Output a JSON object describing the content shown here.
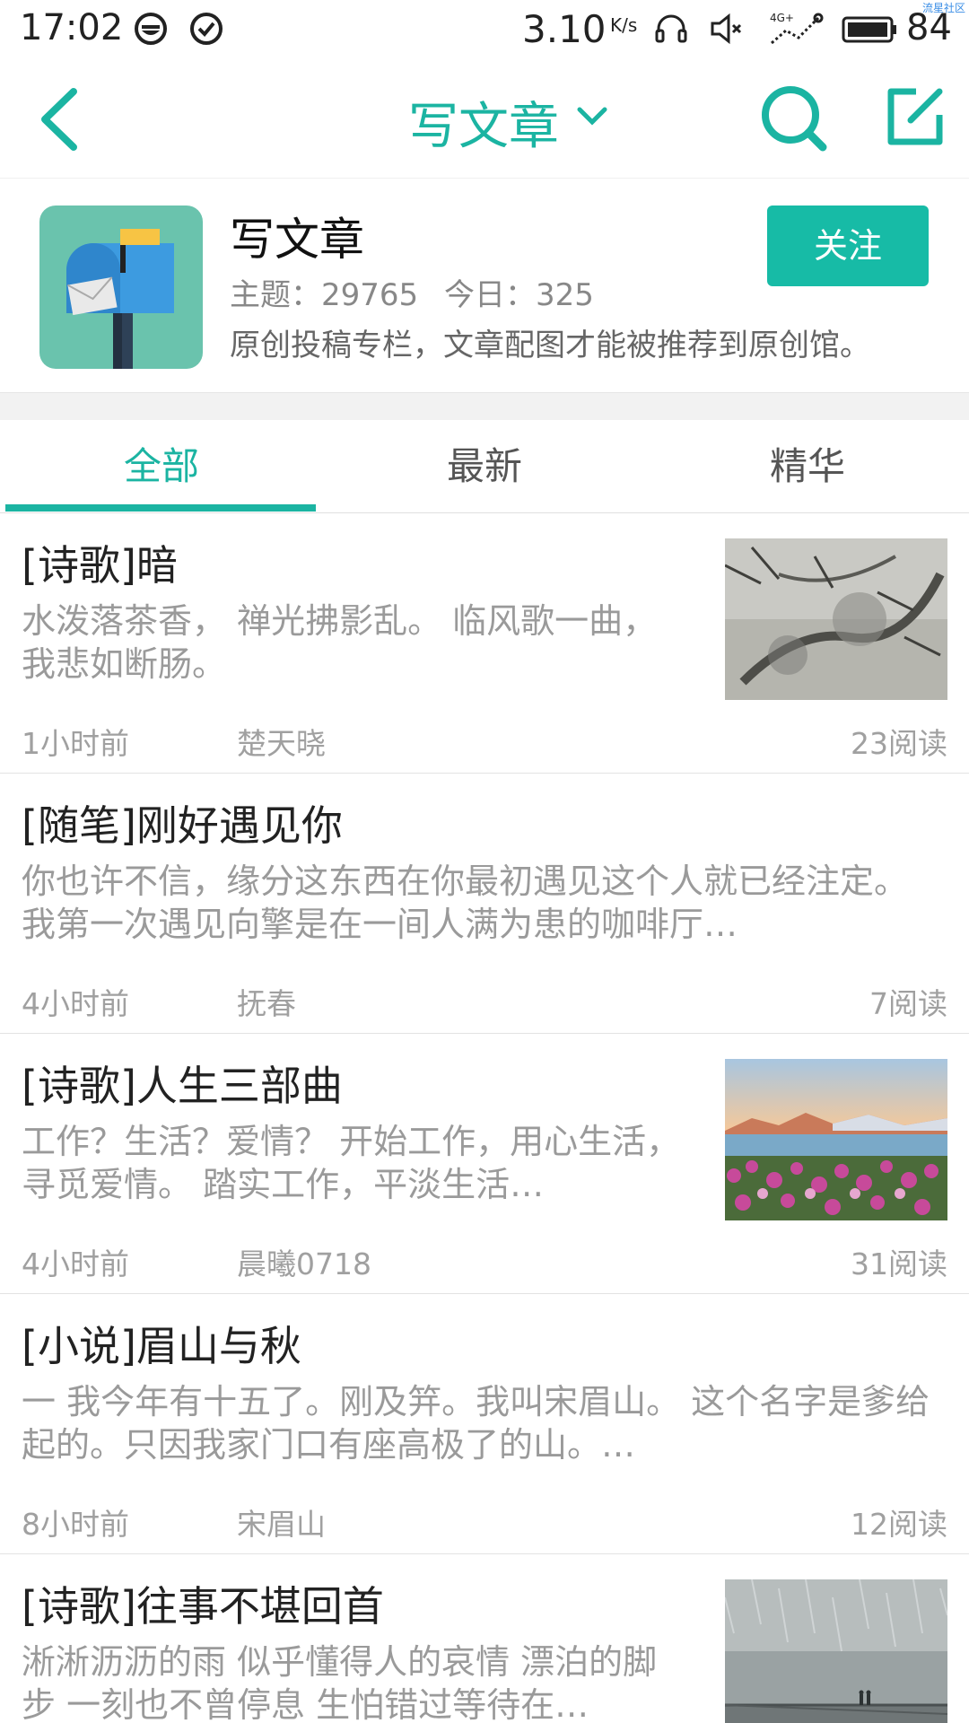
{
  "status_bar": {
    "time": "17:02",
    "net_speed": "3.10",
    "net_speed_unit": "K/s",
    "network_label": "4G+",
    "battery": "84",
    "watermark": "流星社区",
    "icons": [
      "smiley-icon",
      "check-circle-icon",
      "headset-icon",
      "mute-icon",
      "signal-icon",
      "battery-icon"
    ]
  },
  "nav": {
    "title": "写文章",
    "back_icon": "back-icon",
    "dropdown_icon": "chevron-down-icon",
    "search_icon": "search-icon",
    "compose_icon": "compose-icon",
    "accent": "#1bb4a2"
  },
  "forum": {
    "name": "写文章",
    "stats": {
      "topics_label": "主题：29765",
      "today_label": "今日：325"
    },
    "description": "原创投稿专栏，文章配图才能被推荐到原创馆。",
    "follow_label": "关注",
    "logo_icon": "mailbox-icon"
  },
  "tabs": [
    {
      "label": "全部",
      "active": true
    },
    {
      "label": "最新",
      "active": false
    },
    {
      "label": "精华",
      "active": false
    }
  ],
  "posts": [
    {
      "title": "[诗歌]暗",
      "excerpt": "水泼落茶香， 禅光拂影乱。 临风歌一曲， 我悲如断肠。",
      "time": "1小时前",
      "author": "楚天晓",
      "reads": "23阅读",
      "thumbnail": "ink-painting-thumbnail"
    },
    {
      "title": "[随笔]刚好遇见你",
      "excerpt": "你也许不信，缘分这东西在你最初遇见这个人就已经注定。   我第一次遇见向擎是在一间人满为患的咖啡厅…",
      "time": "4小时前",
      "author": "抚春",
      "reads": "7阅读",
      "thumbnail": null
    },
    {
      "title": "[诗歌]人生三部曲",
      "excerpt": "工作？生活？爱情？    开始工作，用心生活，寻觅爱情。    踏实工作，平淡生活…",
      "time": "4小时前",
      "author": "晨曦0718",
      "reads": "31阅读",
      "thumbnail": "lake-flowers-thumbnail"
    },
    {
      "title": "[小说]眉山与秋",
      "excerpt": "一      我今年有十五了。刚及笄。我叫宋眉山。      这个名字是爹给起的。只因我家门口有座高极了的山。…",
      "time": "8小时前",
      "author": "宋眉山",
      "reads": "12阅读",
      "thumbnail": null
    },
    {
      "title": "[诗歌]往事不堪回首",
      "excerpt": "淅淅沥沥的雨 似乎懂得人的哀情 漂泊的脚步 一刻也不曾停息 生怕错过等待在…",
      "time": "",
      "author": "",
      "reads": "",
      "thumbnail": "rain-scene-thumbnail"
    }
  ]
}
